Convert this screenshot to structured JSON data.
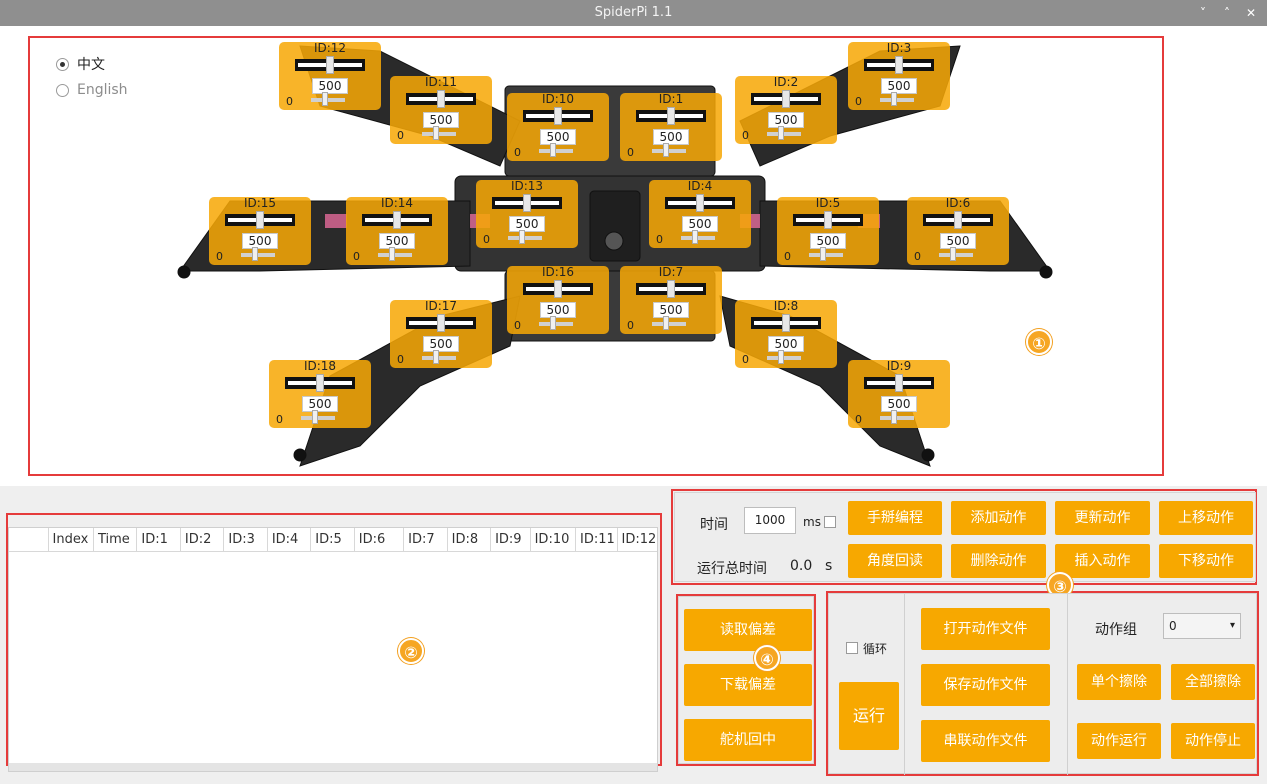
{
  "window": {
    "title": "SpiderPi 1.1",
    "buttons": [
      "˅",
      "˄",
      "✕"
    ]
  },
  "language": {
    "options": [
      "中文",
      "English"
    ],
    "selected": "中文"
  },
  "servos": [
    {
      "id": "ID:12",
      "value": "500",
      "zero": "0"
    },
    {
      "id": "ID:11",
      "value": "500",
      "zero": "0"
    },
    {
      "id": "ID:10",
      "value": "500",
      "zero": "0"
    },
    {
      "id": "ID:1",
      "value": "500",
      "zero": "0"
    },
    {
      "id": "ID:2",
      "value": "500",
      "zero": "0"
    },
    {
      "id": "ID:3",
      "value": "500",
      "zero": "0"
    },
    {
      "id": "ID:15",
      "value": "500",
      "zero": "0"
    },
    {
      "id": "ID:14",
      "value": "500",
      "zero": "0"
    },
    {
      "id": "ID:13",
      "value": "500",
      "zero": "0"
    },
    {
      "id": "ID:4",
      "value": "500",
      "zero": "0"
    },
    {
      "id": "ID:5",
      "value": "500",
      "zero": "0"
    },
    {
      "id": "ID:6",
      "value": "500",
      "zero": "0"
    },
    {
      "id": "ID:16",
      "value": "500",
      "zero": "0"
    },
    {
      "id": "ID:7",
      "value": "500",
      "zero": "0"
    },
    {
      "id": "ID:17",
      "value": "500",
      "zero": "0"
    },
    {
      "id": "ID:8",
      "value": "500",
      "zero": "0"
    },
    {
      "id": "ID:18",
      "value": "500",
      "zero": "0"
    },
    {
      "id": "ID:9",
      "value": "500",
      "zero": "0"
    }
  ],
  "markers": [
    "①",
    "②",
    "③",
    "④"
  ],
  "table": {
    "columns": [
      "",
      "Index",
      "Time",
      "ID:1",
      "ID:2",
      "ID:3",
      "ID:4",
      "ID:5",
      "ID:6",
      "ID:7",
      "ID:8",
      "ID:9",
      "ID:10",
      "ID:11",
      "ID:12"
    ]
  },
  "action_panel": {
    "time_label": "时间",
    "time_value": "1000",
    "time_unit": "ms",
    "total_label": "运行总时间",
    "total_value": "0.0",
    "total_unit": "s",
    "buttons": [
      "手掰编程",
      "添加动作",
      "更新动作",
      "上移动作",
      "角度回读",
      "删除动作",
      "插入动作",
      "下移动作"
    ]
  },
  "deviation_panel": {
    "buttons": [
      "读取偏差",
      "下载偏差",
      "舵机回中"
    ]
  },
  "run_panel": {
    "loop_label": "循环",
    "run_label": "运行",
    "file_buttons": [
      "打开动作文件",
      "保存动作文件",
      "串联动作文件"
    ],
    "group_label": "动作组",
    "group_value": "0",
    "group_buttons": [
      "单个擦除",
      "全部擦除",
      "动作运行",
      "动作停止"
    ]
  },
  "colors": {
    "accent": "#f7a800",
    "highlight": "#e53b3b",
    "titlebar": "#8f8f8f"
  }
}
